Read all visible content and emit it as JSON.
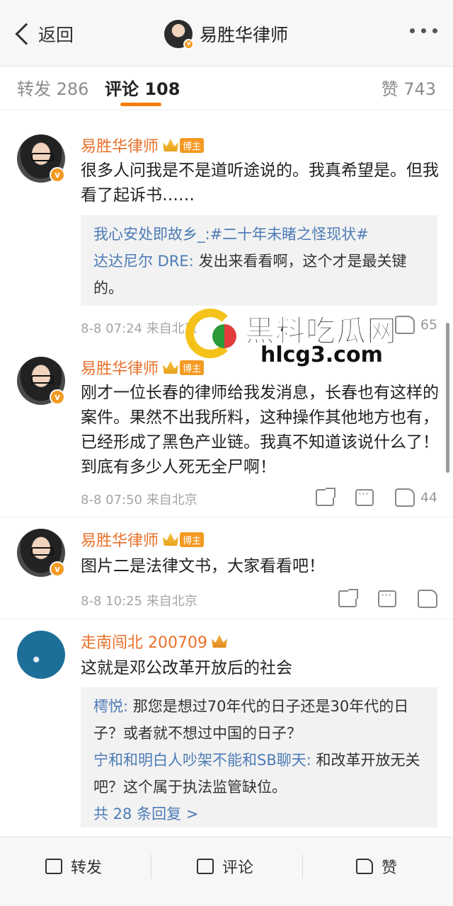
{
  "header": {
    "back_label": "返回",
    "title": "易胜华律师"
  },
  "tabs": {
    "repost": "转发 286",
    "comments": "评论 108",
    "likes": "赞 743"
  },
  "comments": [
    {
      "username": "易胜华律师",
      "badge": "博主",
      "text": "很多人问我是不是道听途说的。我真希望是。但我看了起诉书……",
      "replies": [
        {
          "name": "我心安处即故乡_:",
          "text": "#二十年未睹之怪现状#"
        },
        {
          "name": "达达尼尔 DRE:",
          "text": " 发出来看看啊，这个才是最关键的。"
        }
      ],
      "time": "8-8 07:24",
      "source": "来自北京",
      "likes": "65"
    },
    {
      "username": "易胜华律师",
      "badge": "博主",
      "text": "刚才一位长春的律师给我发消息，长春也有这样的案件。果然不出我所料，这种操作其他地方也有，已经形成了黑色产业链。我真不知道该说什么了！到底有多少人死无全尸啊！",
      "time": "8-8 07:50",
      "source": "来自北京",
      "likes": "44"
    },
    {
      "username": "易胜华律师",
      "badge": "博主",
      "text": "图片二是法律文书，大家看看吧！",
      "time": "8-8 10:25",
      "source": "来自北京",
      "likes": ""
    },
    {
      "username": "走南闯北 200709",
      "text": "这就是邓公改革开放后的社会",
      "replies": [
        {
          "name": "樗悦:",
          "text": " 那您是想过70年代的日子还是30年代的日子？或者就不想过中国的日子？"
        },
        {
          "name": "宁和和明白人吵架不能和SB聊天:",
          "text": " 和改革开放无关吧？这个属于执法监管缺位。"
        }
      ],
      "more_replies": "共 28 条回复 >"
    }
  ],
  "watermark": {
    "title": "黑料吃瓜网",
    "url": "hlcg3.com"
  },
  "bottom": {
    "repost": "转发",
    "comment": "评论",
    "like": "赞"
  },
  "colors": {
    "username": "#e8702a",
    "link": "#4c7bb5",
    "accent": "#f57c00"
  }
}
